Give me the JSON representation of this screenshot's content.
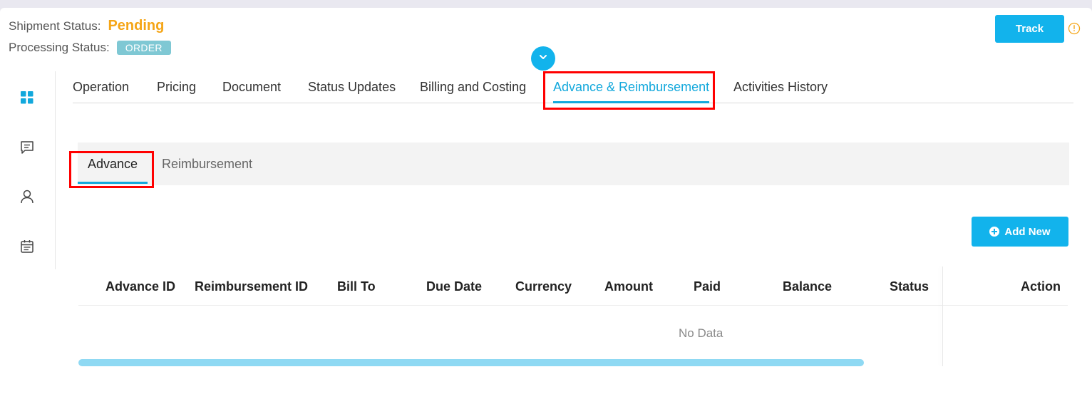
{
  "header": {
    "shipment_status_label": "Shipment Status:",
    "shipment_status_value": "Pending",
    "processing_status_label": "Processing Status:",
    "processing_status_value": "ORDER",
    "track_label": "Track"
  },
  "tabs": [
    {
      "label": "Operation"
    },
    {
      "label": "Pricing"
    },
    {
      "label": "Document"
    },
    {
      "label": "Status Updates"
    },
    {
      "label": "Billing and Costing"
    },
    {
      "label": "Advance & Reimbursement"
    },
    {
      "label": "Activities History"
    }
  ],
  "subtabs": [
    {
      "label": "Advance"
    },
    {
      "label": "Reimbursement"
    }
  ],
  "add_new_label": "Add New",
  "table": {
    "columns": [
      "Advance ID",
      "Reimbursement ID",
      "Bill To",
      "Due Date",
      "Currency",
      "Amount",
      "Paid",
      "Balance",
      "Status",
      "Action"
    ],
    "empty_text": "No Data"
  },
  "colors": {
    "accent": "#12b3ec",
    "pending": "#f5a516",
    "badge": "#7fc8d4",
    "highlight": "#ff0000"
  },
  "icons": {
    "sidebar": [
      "dashboard-icon",
      "chat-icon",
      "user-icon",
      "calendar-icon"
    ],
    "info": "info-icon",
    "collapse": "chevron-down-icon",
    "add": "plus-circle-icon"
  }
}
